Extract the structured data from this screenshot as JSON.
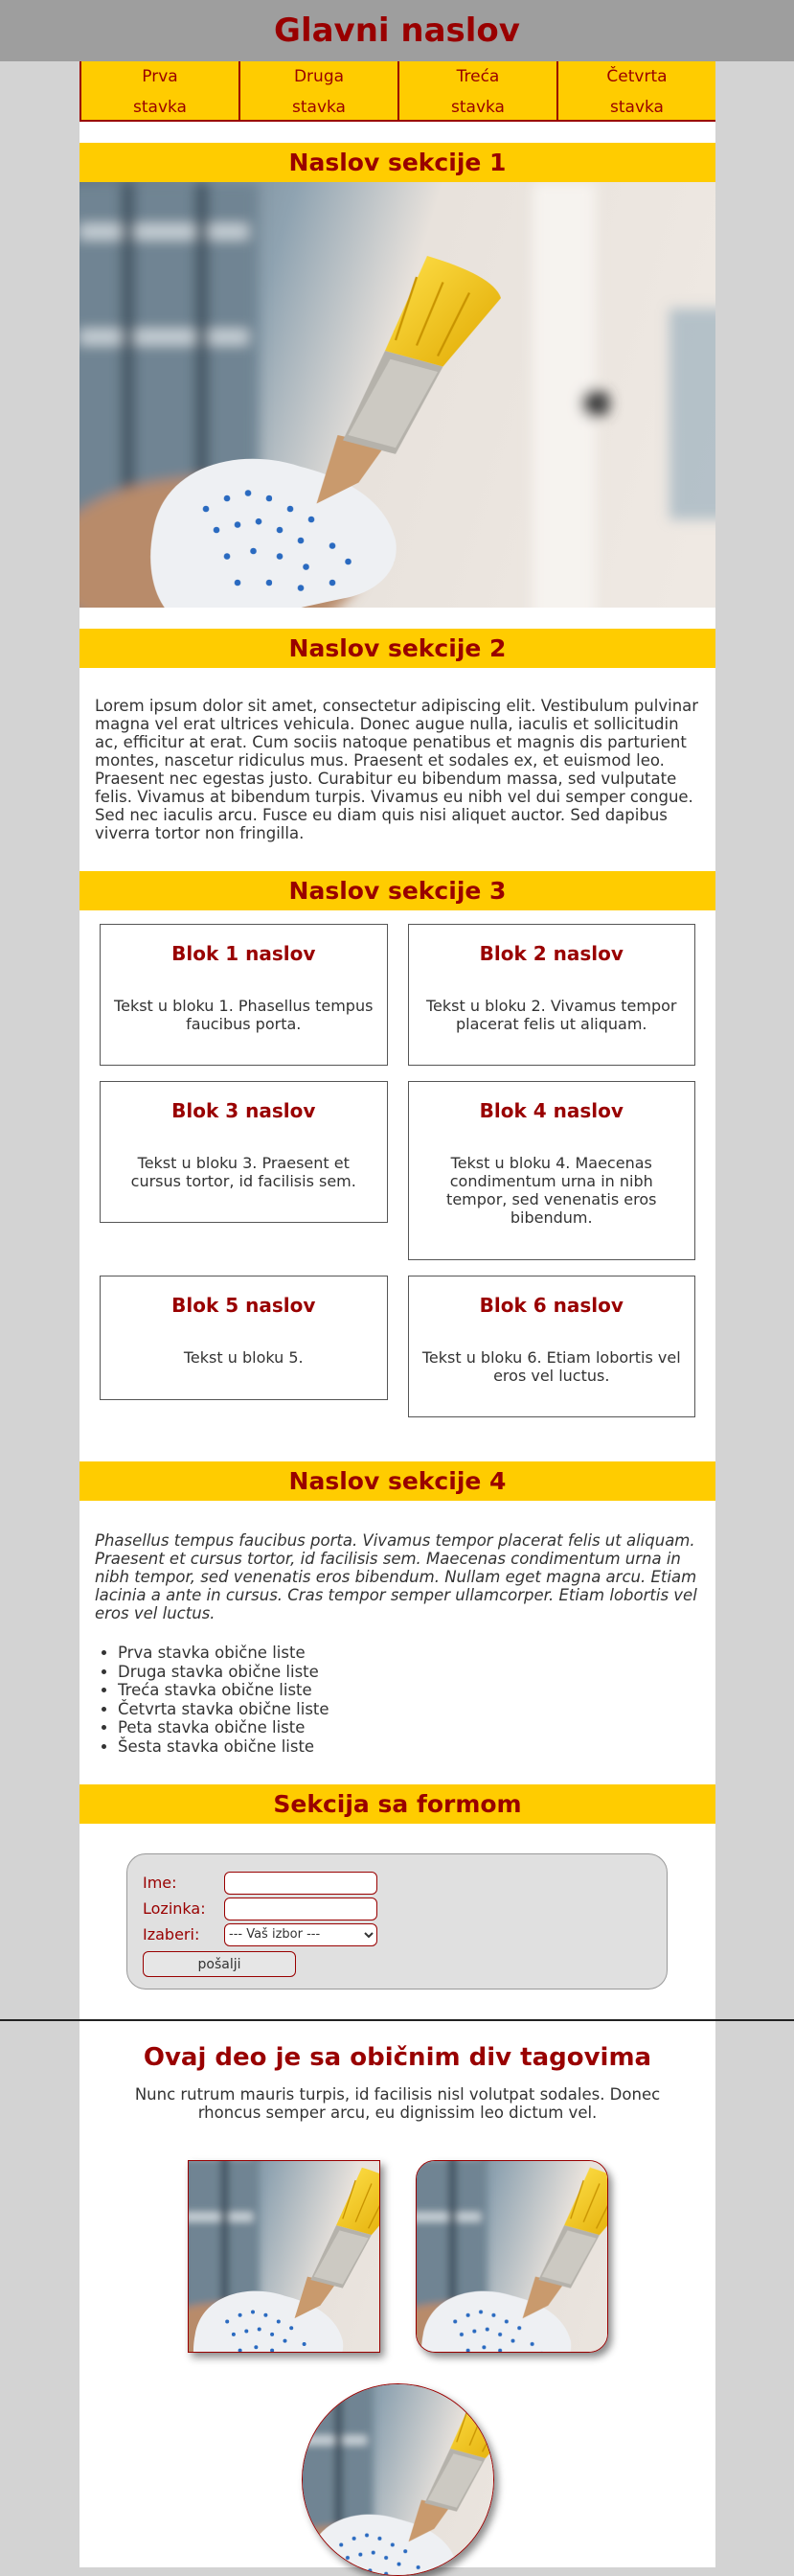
{
  "header": {
    "title": "Glavni naslov"
  },
  "nav": {
    "items": [
      {
        "line1": "Prva",
        "line2": "stavka"
      },
      {
        "line1": "Druga",
        "line2": "stavka"
      },
      {
        "line1": "Treća",
        "line2": "stavka"
      },
      {
        "line1": "Četvrta",
        "line2": "stavka"
      }
    ]
  },
  "section1": {
    "title": "Naslov sekcije 1"
  },
  "section2": {
    "title": "Naslov sekcije 2",
    "text": "Lorem ipsum dolor sit amet, consectetur adipiscing elit. Vestibulum pulvinar magna vel erat ultrices vehicula. Donec augue nulla, iaculis et sollicitudin ac, efficitur at erat. Cum sociis natoque penatibus et magnis dis parturient montes, nascetur ridiculus mus. Praesent et sodales ex, et euismod leo. Praesent nec egestas justo. Curabitur eu bibendum massa, sed vulputate felis. Vivamus at bibendum turpis. Vivamus eu nibh vel dui semper congue. Sed nec iaculis arcu. Fusce eu diam quis nisi aliquet auctor. Sed dapibus viverra tortor non fringilla."
  },
  "section3": {
    "title": "Naslov sekcije 3",
    "blocks": [
      {
        "title": "Blok 1 naslov",
        "text": "Tekst u bloku 1. Phasellus tempus faucibus porta."
      },
      {
        "title": "Blok 2 naslov",
        "text": "Tekst u bloku 2. Vivamus tempor placerat felis ut aliquam."
      },
      {
        "title": "Blok 3 naslov",
        "text": "Tekst u bloku 3. Praesent et cursus tortor, id facilisis sem."
      },
      {
        "title": "Blok 4 naslov",
        "text": "Tekst u bloku 4. Maecenas condimentum urna in nibh tempor, sed venenatis eros bibendum."
      },
      {
        "title": "Blok 5 naslov",
        "text": "Tekst u bloku 5."
      },
      {
        "title": "Blok 6 naslov",
        "text": "Tekst u bloku 6. Etiam lobortis vel eros vel luctus."
      }
    ]
  },
  "section4": {
    "title": "Naslov sekcije 4",
    "italic": "Phasellus tempus faucibus porta. Vivamus tempor placerat felis ut aliquam. Praesent et cursus tortor, id facilisis sem. Maecenas condimentum urna in nibh tempor, sed venenatis eros bibendum. Nullam eget magna arcu. Etiam lacinia a ante in cursus. Cras tempor semper ullamcorper. Etiam lobortis vel eros vel luctus.",
    "list": [
      "Prva stavka obične liste",
      "Druga stavka obične liste",
      "Treća stavka obične liste",
      "Četvrta stavka obične liste",
      "Peta stavka obične liste",
      "Šesta stavka obične liste"
    ]
  },
  "form": {
    "title": "Sekcija sa formom",
    "name_label": "Ime:",
    "password_label": "Lozinka:",
    "select_label": "Izaberi:",
    "select_value": "--- Vaš izbor ---",
    "submit_label": "pošalji"
  },
  "div_section": {
    "title": "Ovaj deo je sa običnim div tagovima",
    "text": "Nunc rutrum mauris turpis, id facilisis nisl volutpat sodales. Donec rhoncus semper arcu, eu dignissim leo dictum vel."
  },
  "colors": {
    "accent": "#ffcc00",
    "brand": "#990000",
    "page_bg": "#d3d3d3",
    "header_bg": "#9e9e9e"
  }
}
